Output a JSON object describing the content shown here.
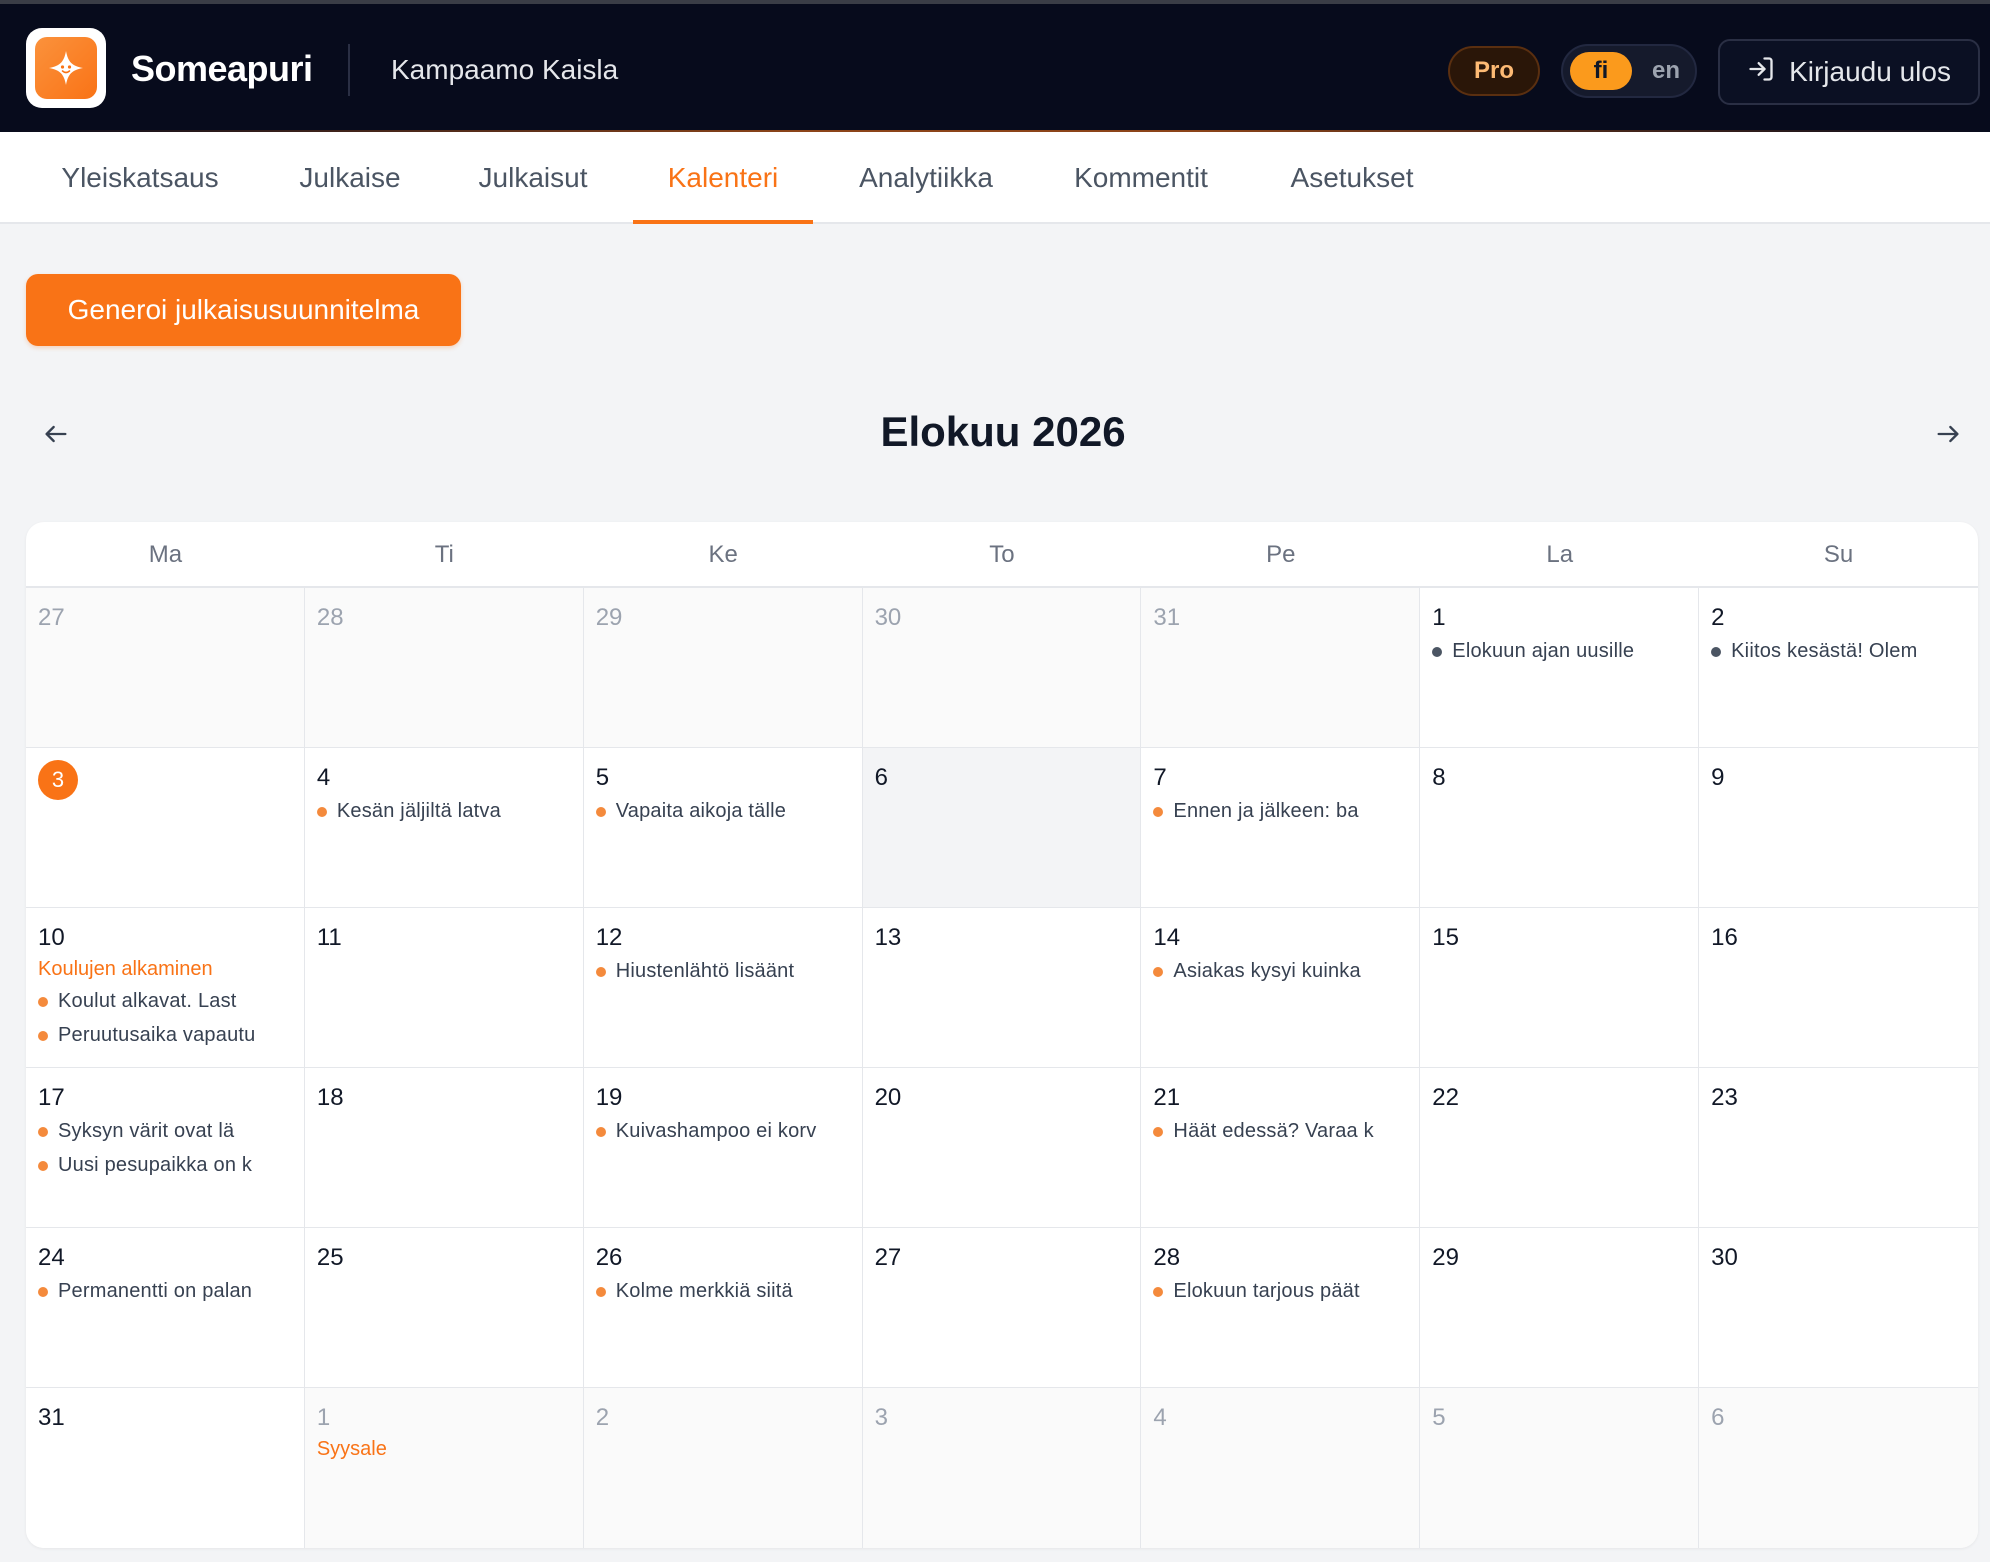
{
  "app": {
    "brand": "Someapuri",
    "workspace": "Kampaamo Kaisla",
    "plan_badge": "Pro",
    "languages": [
      "fi",
      "en"
    ],
    "active_language": "fi",
    "logout_label": "Kirjaudu ulos"
  },
  "tabs": [
    {
      "label": "Yleiskatsaus",
      "active": false
    },
    {
      "label": "Julkaise",
      "active": false
    },
    {
      "label": "Julkaisut",
      "active": false
    },
    {
      "label": "Kalenteri",
      "active": true
    },
    {
      "label": "Analytiikka",
      "active": false
    },
    {
      "label": "Kommentit",
      "active": false
    },
    {
      "label": "Asetukset",
      "active": false
    }
  ],
  "actions": {
    "generate_label": "Generoi julkaisusuunnitelma"
  },
  "calendar": {
    "title": "Elokuu 2026",
    "weekdays": [
      "Ma",
      "Ti",
      "Ke",
      "To",
      "Pe",
      "La",
      "Su"
    ],
    "today": 3,
    "colors": {
      "accent": "#f97316",
      "published": "#4b5563",
      "scheduled": "#f48a3c"
    },
    "weeks": [
      [
        {
          "day": "27",
          "other": true
        },
        {
          "day": "28",
          "other": true
        },
        {
          "day": "29",
          "other": true
        },
        {
          "day": "30",
          "other": true
        },
        {
          "day": "31",
          "other": true
        },
        {
          "day": "1",
          "events": [
            {
              "text": "Elokuun ajan uusille",
              "status": "published"
            }
          ]
        },
        {
          "day": "2",
          "events": [
            {
              "text": "Kiitos kesästä! Olem",
              "status": "published"
            }
          ]
        }
      ],
      [
        {
          "day": "3",
          "today": true
        },
        {
          "day": "4",
          "events": [
            {
              "text": "Kesän jäljiltä latva",
              "status": "scheduled"
            }
          ]
        },
        {
          "day": "5",
          "events": [
            {
              "text": "Vapaita aikoja tälle",
              "status": "scheduled"
            }
          ]
        },
        {
          "day": "6",
          "hover": true
        },
        {
          "day": "7",
          "events": [
            {
              "text": "Ennen ja jälkeen: ba",
              "status": "scheduled"
            }
          ]
        },
        {
          "day": "8"
        },
        {
          "day": "9"
        }
      ],
      [
        {
          "day": "10",
          "holiday": "Koulujen alkaminen",
          "events": [
            {
              "text": "Koulut alkavat. Last",
              "status": "scheduled"
            },
            {
              "text": "Peruutusaika vapautu",
              "status": "scheduled"
            }
          ]
        },
        {
          "day": "11"
        },
        {
          "day": "12",
          "events": [
            {
              "text": "Hiustenlähtö lisäänt",
              "status": "scheduled"
            }
          ]
        },
        {
          "day": "13"
        },
        {
          "day": "14",
          "events": [
            {
              "text": "Asiakas kysyi kuinka",
              "status": "scheduled"
            }
          ]
        },
        {
          "day": "15"
        },
        {
          "day": "16"
        }
      ],
      [
        {
          "day": "17",
          "events": [
            {
              "text": "Syksyn värit ovat lä",
              "status": "scheduled"
            },
            {
              "text": "Uusi pesupaikka on k",
              "status": "scheduled"
            }
          ]
        },
        {
          "day": "18"
        },
        {
          "day": "19",
          "events": [
            {
              "text": "Kuivashampoo ei korv",
              "status": "scheduled"
            }
          ]
        },
        {
          "day": "20"
        },
        {
          "day": "21",
          "events": [
            {
              "text": "Häät edessä? Varaa k",
              "status": "scheduled"
            }
          ]
        },
        {
          "day": "22"
        },
        {
          "day": "23"
        }
      ],
      [
        {
          "day": "24",
          "events": [
            {
              "text": "Permanentti on palan",
              "status": "scheduled"
            }
          ]
        },
        {
          "day": "25"
        },
        {
          "day": "26",
          "events": [
            {
              "text": "Kolme merkkiä siitä",
              "status": "scheduled"
            }
          ]
        },
        {
          "day": "27"
        },
        {
          "day": "28",
          "events": [
            {
              "text": "Elokuun tarjous päät",
              "status": "scheduled"
            }
          ]
        },
        {
          "day": "29"
        },
        {
          "day": "30"
        }
      ],
      [
        {
          "day": "31"
        },
        {
          "day": "1",
          "other": true,
          "holiday": "Syysale"
        },
        {
          "day": "2",
          "other": true
        },
        {
          "day": "3",
          "other": true
        },
        {
          "day": "4",
          "other": true
        },
        {
          "day": "5",
          "other": true
        },
        {
          "day": "6",
          "other": true
        }
      ]
    ]
  }
}
